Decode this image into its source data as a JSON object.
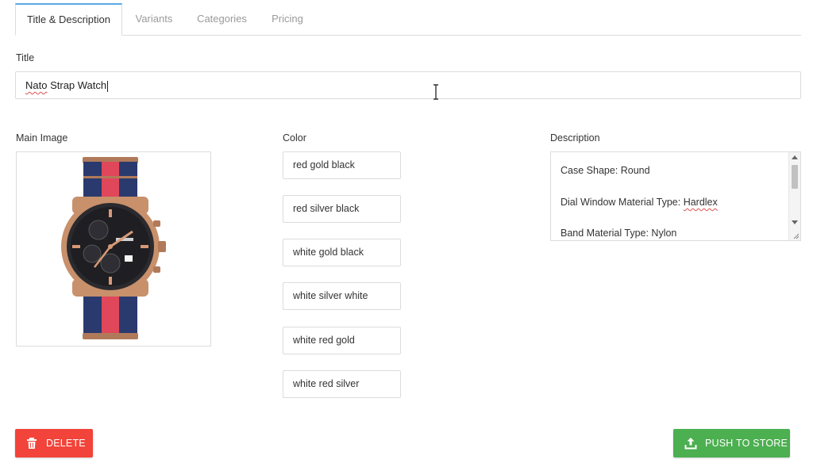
{
  "tabs": [
    {
      "label": "Title & Description",
      "active": true
    },
    {
      "label": "Variants",
      "active": false
    },
    {
      "label": "Categories",
      "active": false
    },
    {
      "label": "Pricing",
      "active": false
    }
  ],
  "title_section": {
    "label": "Title",
    "value_misspelled": "Nato",
    "value_rest": " Strap Watch"
  },
  "main_image": {
    "label": "Main Image",
    "icon": "nato-strap-watch-image"
  },
  "color": {
    "label": "Color",
    "options": [
      "red gold black",
      "red silver black",
      "white gold black",
      "white silver white",
      "white red gold",
      "white red silver"
    ]
  },
  "description": {
    "label": "Description",
    "lines": [
      {
        "prefix": "Case Shape: Round",
        "flagged": ""
      },
      {
        "prefix": "Dial Window Material Type: ",
        "flagged": "Hardlex"
      },
      {
        "prefix": "Band Material Type: Nylon",
        "flagged": ""
      }
    ]
  },
  "actions": {
    "delete_label": "DELETE",
    "push_label": "PUSH TO STORE"
  },
  "colors": {
    "tab_accent": "#5aa9e6",
    "delete": "#f2443a",
    "push": "#4caf50"
  }
}
